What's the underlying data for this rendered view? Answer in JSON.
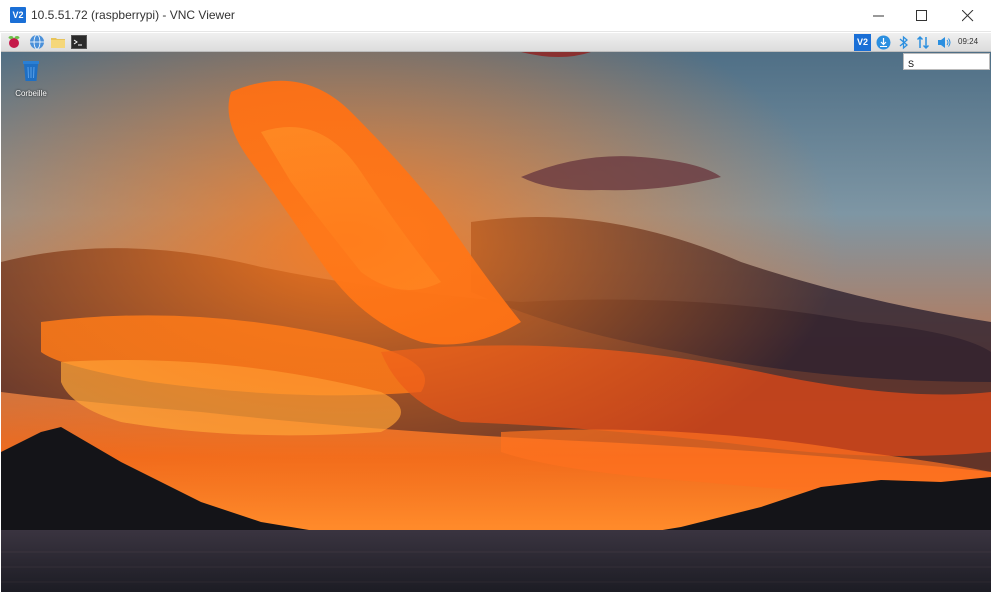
{
  "window": {
    "app_icon_text": "V2",
    "title": "10.5.51.72 (raspberrypi) - VNC Viewer"
  },
  "taskbar": {
    "launchers": [
      "raspberry-pi-menu",
      "web-browser",
      "file-manager",
      "terminal"
    ],
    "tray": {
      "vnc_icon_text": "V2",
      "clock": "09:24"
    },
    "search_popup": {
      "value": "S"
    }
  },
  "desktop": {
    "icons": [
      {
        "label": "Corbeille",
        "icon": "trash-icon"
      }
    ]
  },
  "colors": {
    "taskbar_bg": "#e6e6e6",
    "vnc_blue": "#1a6fd6",
    "tray_blue": "#2b8fe0"
  }
}
